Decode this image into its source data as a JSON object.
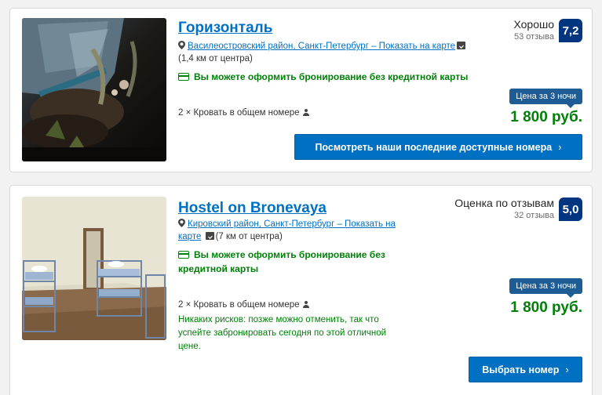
{
  "colors": {
    "link": "#0071c2",
    "green": "#008009",
    "score_bg": "#003580",
    "badge_bg": "#1d5c95"
  },
  "listings": [
    {
      "name": "Горизонталь",
      "location_link": "Василеостровский район, Санкт-Петербург – Показать на карте",
      "distance": "(1,4 км от центра)",
      "no_card": "Вы можете оформить бронирование без кредитной карты",
      "bed": "2 × Кровать в общем номере",
      "rating_word": "Хорошо",
      "reviews": "53 отзыва",
      "score": "7,2",
      "price_badge": "Цена за 3 ночи",
      "price": "1 800 руб.",
      "button": "Посмотреть наши последние доступные номера",
      "button_chevron": "›"
    },
    {
      "name": "Hostel on Bronevaya",
      "location_link_1": "Кировский район, Санкт-Петербург – Показать на",
      "location_link_2": "карте",
      "distance": "(7 км от центра)",
      "no_card_1": "Вы можете оформить бронирование без",
      "no_card_2": "кредитной карты",
      "bed": "2 × Кровать в общем номере",
      "no_risk_1": "Никаких рисков: позже можно отменить, так что",
      "no_risk_2": "успейте забронировать сегодня по этой отличной",
      "no_risk_3": "цене.",
      "rating_word": "Оценка по отзывам",
      "reviews": "32 отзыва",
      "score": "5,0",
      "price_badge": "Цена за 3 ночи",
      "price": "1 800 руб.",
      "button": "Выбрать номер",
      "button_chevron": "›"
    }
  ]
}
